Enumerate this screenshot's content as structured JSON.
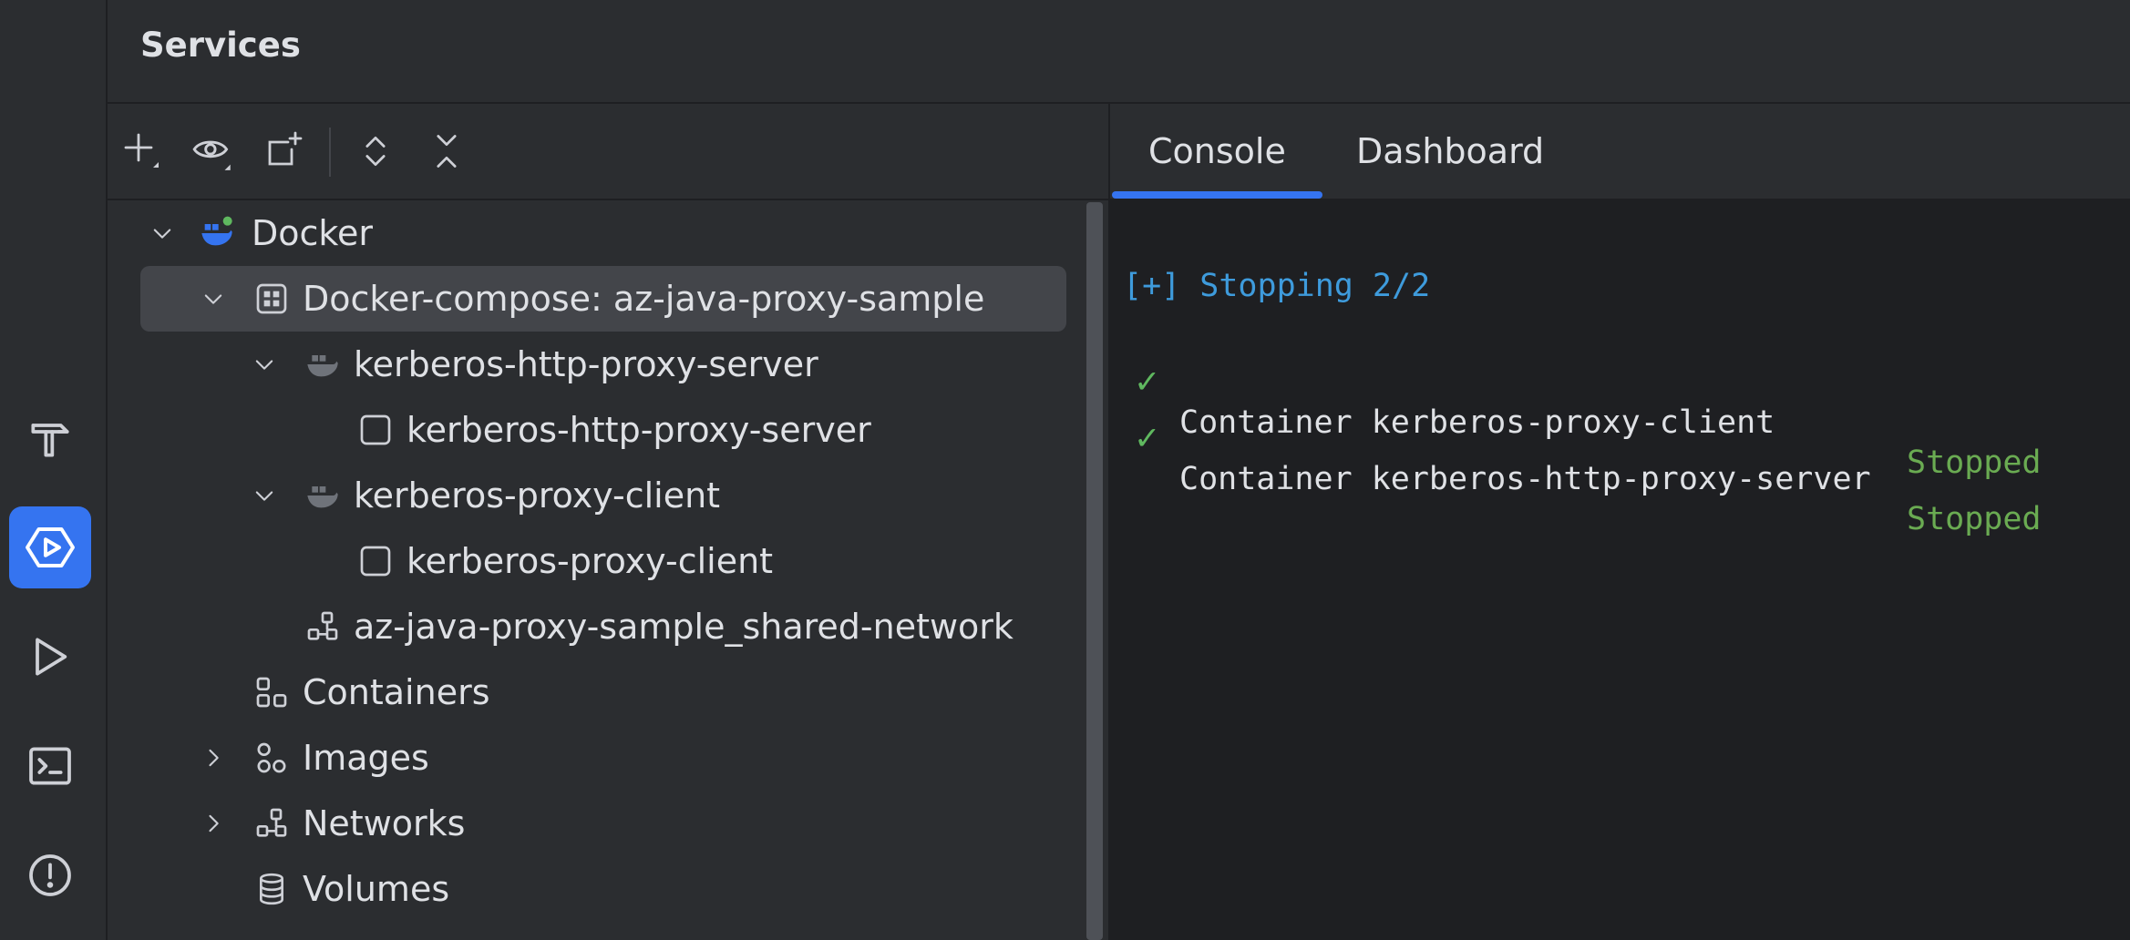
{
  "header": {
    "title": "Services"
  },
  "toolbar": {
    "buttons": [
      "add-icon",
      "eye-icon",
      "new-service-icon",
      "expand-all-icon",
      "collapse-all-icon"
    ]
  },
  "tree": {
    "items": [
      {
        "label": "Docker",
        "expanded": true
      },
      {
        "label": "Docker-compose: az-java-proxy-sample",
        "expanded": true,
        "selected": true
      },
      {
        "label": "kerberos-http-proxy-server",
        "expanded": true
      },
      {
        "label": "kerberos-http-proxy-server"
      },
      {
        "label": "kerberos-proxy-client",
        "expanded": true
      },
      {
        "label": "kerberos-proxy-client"
      },
      {
        "label": "az-java-proxy-sample_shared-network"
      },
      {
        "label": "Containers"
      },
      {
        "label": "Images",
        "expanded": false
      },
      {
        "label": "Networks",
        "expanded": false
      },
      {
        "label": "Volumes"
      }
    ]
  },
  "tabs": [
    {
      "label": "Console",
      "active": true
    },
    {
      "label": "Dashboard",
      "active": false
    }
  ],
  "console": {
    "header_line": "[+] Stopping 2/2",
    "lines": [
      {
        "check": "✓",
        "name": "Container kerberos-proxy-client",
        "status": "Stopped"
      },
      {
        "check": "✓",
        "name": "Container kerberos-http-proxy-server",
        "status": "Stopped"
      }
    ]
  },
  "colors": {
    "accent": "#3574f0",
    "status_ok": "#6aab52",
    "console_blue": "#3e9bdc",
    "docker_blue": "#3574f0",
    "docker_dot": "#5fb85f"
  }
}
